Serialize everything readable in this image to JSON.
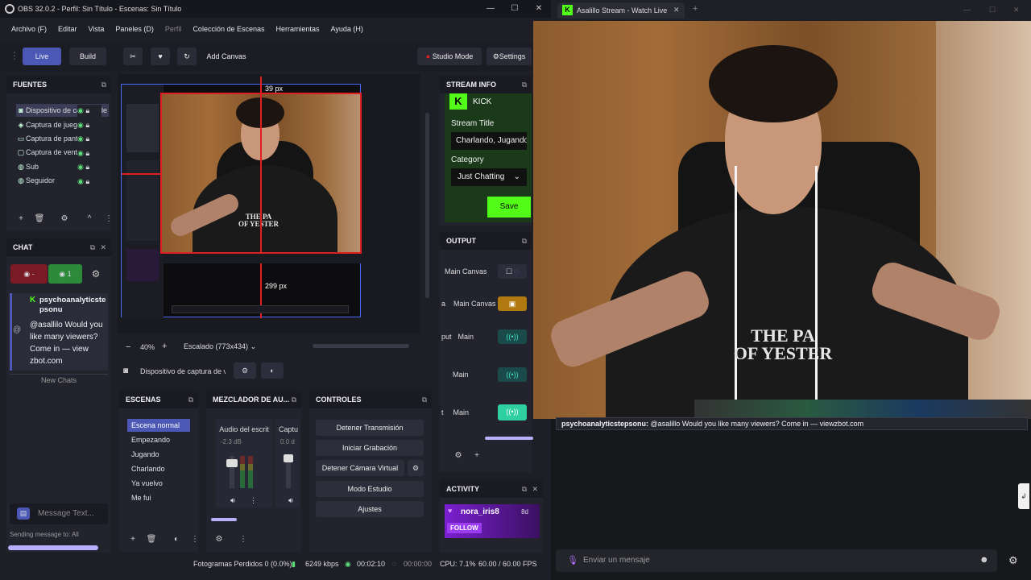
{
  "obs": {
    "window_title": "OBS 32.0.2 - Perfil: Sin Título - Escenas: Sin Título",
    "menu": [
      "Archivo (F)",
      "Editar",
      "Vista",
      "Paneles (D)",
      "Perfil",
      "Colección de Escenas",
      "Herramientas",
      "Ayuda (H)"
    ],
    "toolbar": {
      "live": "Live",
      "build": "Build",
      "add_canvas": "Add Canvas",
      "studio_mode": "Studio Mode",
      "settings": "Settings"
    },
    "sources": {
      "title": "FUENTES",
      "items": [
        "Dispositivo de captura de vídeo",
        "Captura de juego",
        "Captura de pantalla",
        "Captura de ventana",
        "Sub",
        "Seguidor"
      ]
    },
    "chat": {
      "title": "CHAT",
      "hidden_count": "-",
      "visible_count": "1",
      "message_user": "psychoanalyticstepsonu",
      "message_text": "@asallilo Would you like many viewers? Come in — view zbot.com",
      "new_chats": "New Chats",
      "input_placeholder": "Message Text...",
      "sending_to": "Sending message to: All"
    },
    "preview": {
      "top_measure": "39 px",
      "bottom_measure": "299 px",
      "zoom": "40%",
      "scale": "Escalado (773x434)",
      "source_selected": "Dispositivo de captura de vídeo"
    },
    "scenes": {
      "title": "ESCENAS",
      "items": [
        "Escena normal",
        "Empezando",
        "Jugando",
        "Charlando",
        "Ya vuelvo",
        "Me fui"
      ]
    },
    "mixer": {
      "title": "MEZCLADOR DE AU...",
      "channels": [
        {
          "name": "Audio del escrit",
          "db": "-2.3 dB"
        },
        {
          "name": "Captu",
          "db": "0.0 d"
        }
      ]
    },
    "controls": {
      "title": "CONTROLES",
      "buttons": [
        "Detener Transmisión",
        "Iniciar Grabación",
        "Detener Cámara Virtual",
        "Modo Estudio",
        "Ajustes"
      ]
    },
    "stream_info": {
      "title": "STREAM INFO",
      "platform": "KICK",
      "stream_title_label": "Stream Title",
      "stream_title_value": "Charlando, Jugando",
      "category_label": "Category",
      "category_value": "Just Chatting",
      "save": "Save"
    },
    "output": {
      "title": "OUTPUT",
      "rows": [
        "Main Canvas",
        "Main Canvas",
        "Main",
        "Main",
        "Main"
      ],
      "row_prefixes": [
        "",
        "a",
        "put",
        "",
        "t"
      ]
    },
    "activity": {
      "title": "ACTIVITY",
      "user": "nora_iris8",
      "time": "8d",
      "action": "FOLLOW"
    },
    "status": {
      "dropped_frames": "Fotogramas Perdidos 0 (0.0%)",
      "bitrate": "6249 kbps",
      "live_time": "00:02:10",
      "rec_time": "00:00:00",
      "cpu": "CPU: 7.1%",
      "fps": "60.00 / 60.00 FPS"
    }
  },
  "browser": {
    "tab_title": "Asalillo Stream - Watch Live on K",
    "chat_line_user": "psychoanalyticstepsonu:",
    "chat_line_text": "@asalillo Would you like many viewers? Come in — viewzbot.com",
    "input_placeholder": "Enviar un mensaje"
  },
  "shirt": {
    "line1": "THE PA",
    "line2": "OF YESTER"
  },
  "colors": {
    "kick_green": "#53fc18",
    "accent_blue": "#4b58b5",
    "record_red": "#e02020",
    "activity_purple": "#7a1fd0"
  }
}
